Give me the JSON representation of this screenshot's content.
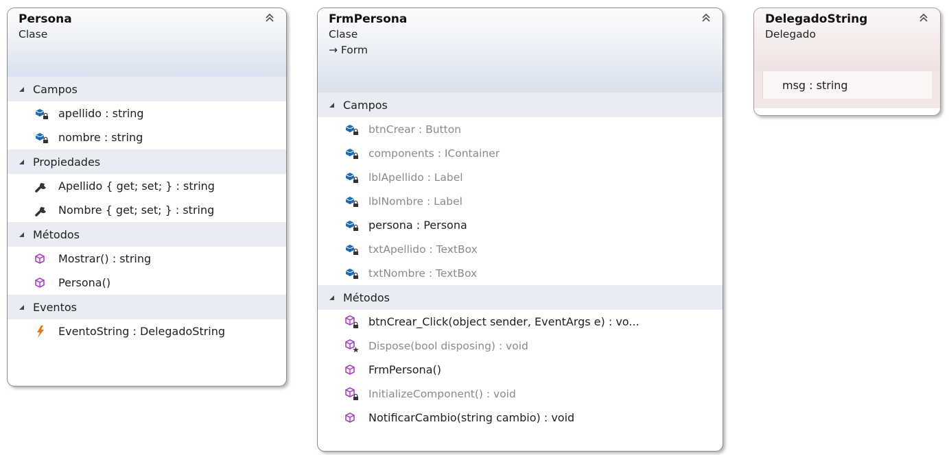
{
  "diagram": {
    "persona": {
      "title": "Persona",
      "kind": "Clase",
      "sections": [
        {
          "name": "Campos",
          "members": [
            {
              "text": "apellido : string",
              "icon": "private-field-icon",
              "dim": false
            },
            {
              "text": "nombre : string",
              "icon": "private-field-icon",
              "dim": false
            }
          ]
        },
        {
          "name": "Propiedades",
          "members": [
            {
              "text": "Apellido { get; set; } : string",
              "icon": "property-wrench-icon",
              "dim": false
            },
            {
              "text": "Nombre { get; set; } : string",
              "icon": "property-wrench-icon",
              "dim": false
            }
          ]
        },
        {
          "name": "Métodos",
          "members": [
            {
              "text": "Mostrar() : string",
              "icon": "public-method-icon",
              "dim": false
            },
            {
              "text": "Persona()",
              "icon": "public-method-icon",
              "dim": false
            }
          ]
        },
        {
          "name": "Eventos",
          "members": [
            {
              "text": "EventoString : DelegadoString",
              "icon": "event-lightning-icon",
              "dim": false
            }
          ]
        }
      ]
    },
    "frmpersona": {
      "title": "FrmPersona",
      "kind": "Clase",
      "base": "→ Form",
      "sections": [
        {
          "name": "Campos",
          "members": [
            {
              "text": "btnCrear : Button",
              "icon": "private-field-icon",
              "dim": true
            },
            {
              "text": "components : IContainer",
              "icon": "private-field-icon",
              "dim": true
            },
            {
              "text": "lblApellido : Label",
              "icon": "private-field-icon",
              "dim": true
            },
            {
              "text": "lblNombre : Label",
              "icon": "private-field-icon",
              "dim": true
            },
            {
              "text": "persona : Persona",
              "icon": "private-field-icon",
              "dim": false
            },
            {
              "text": "txtApellido : TextBox",
              "icon": "private-field-icon",
              "dim": true
            },
            {
              "text": "txtNombre : TextBox",
              "icon": "private-field-icon",
              "dim": true
            }
          ]
        },
        {
          "name": "Métodos",
          "members": [
            {
              "text": "btnCrear_Click(object sender, EventArgs e) : vo...",
              "icon": "private-method-icon",
              "dim": false
            },
            {
              "text": "Dispose(bool disposing) : void",
              "icon": "protected-method-icon",
              "dim": true
            },
            {
              "text": "FrmPersona()",
              "icon": "public-method-icon",
              "dim": false
            },
            {
              "text": "InitializeComponent() : void",
              "icon": "private-method-icon",
              "dim": true
            },
            {
              "text": "NotificarCambio(string cambio) : void",
              "icon": "public-method-icon",
              "dim": false
            }
          ]
        }
      ]
    },
    "delegado": {
      "title": "DelegadoString",
      "kind": "Delegado",
      "members": [
        {
          "text": "msg : string"
        }
      ]
    }
  },
  "colors": {
    "field_icon": "#1f6fb8",
    "method_icon": "#9b3fb3",
    "event_icon": "#e07a10",
    "section_bg": "#e9edf3"
  }
}
